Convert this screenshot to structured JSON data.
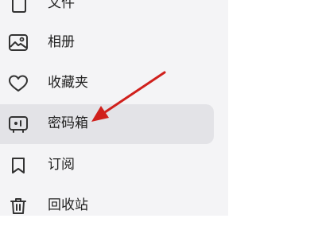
{
  "sidebar": {
    "items": [
      {
        "label": "文件",
        "icon": "file-icon"
      },
      {
        "label": "相册",
        "icon": "image-icon"
      },
      {
        "label": "收藏夹",
        "icon": "heart-icon"
      },
      {
        "label": "密码箱",
        "icon": "safe-icon",
        "selected": true
      },
      {
        "label": "订阅",
        "icon": "bookmark-icon"
      },
      {
        "label": "回收站",
        "icon": "trash-icon"
      }
    ]
  },
  "annotation": {
    "arrow_color": "#d0201c"
  },
  "colors": {
    "sidebar_bg": "#f4f4f6",
    "selected_bg": "#e3e3e7",
    "text": "#222222",
    "icon": "#333333"
  }
}
